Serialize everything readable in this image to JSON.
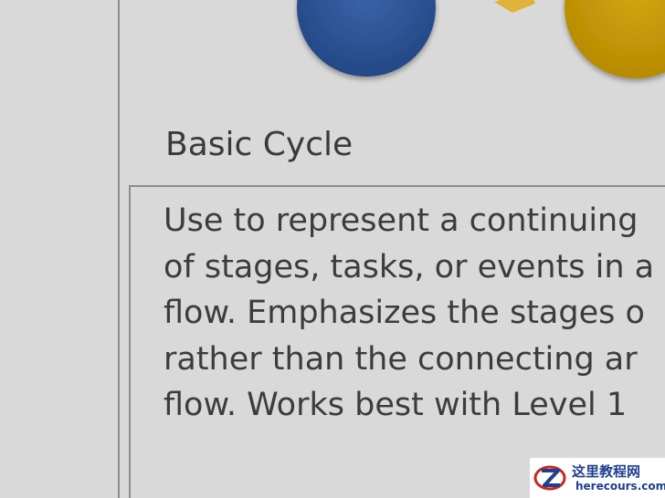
{
  "layout_option": {
    "title": "Basic Cycle",
    "description_lines": [
      "Use to represent a continuing",
      "of stages, tasks, or events in a",
      "flow. Emphasizes the stages o",
      "rather than the connecting ar",
      "flow. Works best with Level 1"
    ]
  },
  "colors": {
    "circle_blue": "#2f5597",
    "circle_gold": "#c59a00",
    "arrow_gold": "#e0b23a"
  },
  "watermark": {
    "cn_text": "这里教程网",
    "en_text": "herecours.com",
    "logo_icon": "z-logo-icon"
  }
}
